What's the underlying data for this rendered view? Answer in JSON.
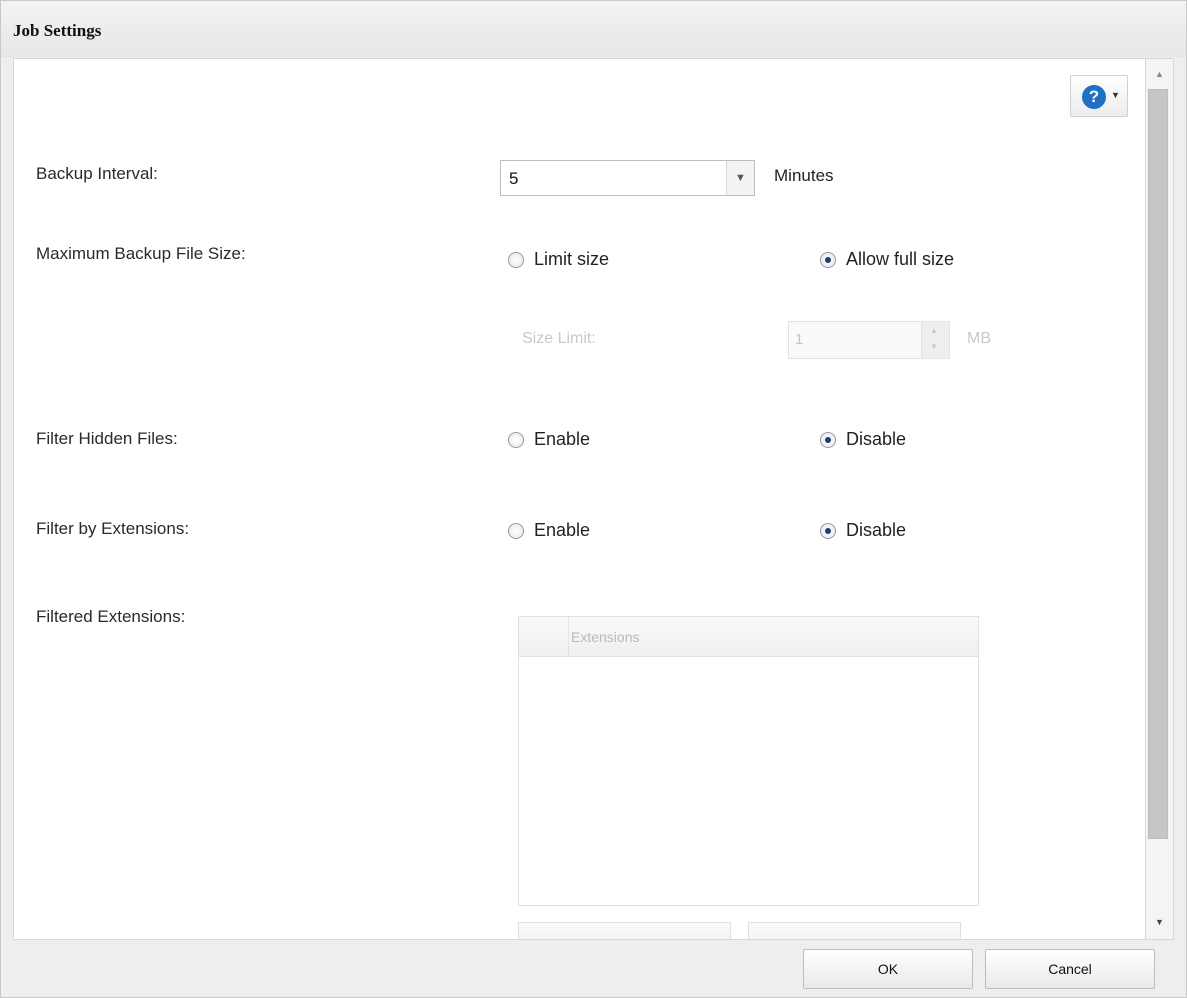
{
  "dialog": {
    "title": "Job Settings",
    "help_icon": "question-circle-icon",
    "help_glyph": "?"
  },
  "form": {
    "backup_interval": {
      "label": "Backup Interval:",
      "value": "5",
      "unit": "Minutes"
    },
    "max_backup_size": {
      "label": "Maximum Backup File Size:",
      "options": [
        "Limit size",
        "Allow full size"
      ],
      "selected": "Allow full size"
    },
    "size_limit": {
      "label": "Size Limit:",
      "value": "1",
      "unit": "MB",
      "disabled": true
    },
    "filter_hidden": {
      "label": "Filter Hidden Files:",
      "options": [
        "Enable",
        "Disable"
      ],
      "selected": "Disable"
    },
    "filter_extensions": {
      "label": "Filter by Extensions:",
      "options": [
        "Enable",
        "Disable"
      ],
      "selected": "Disable"
    },
    "filtered_extensions": {
      "label": "Filtered Extensions:",
      "columns": [
        "Extensions"
      ],
      "rows": [],
      "disabled": true
    }
  },
  "footer": {
    "ok_label": "OK",
    "cancel_label": "Cancel"
  },
  "colors": {
    "accent": "#1f6fc4",
    "radio_selected": "#1b3f73",
    "disabled_text": "#c9c9c9"
  }
}
